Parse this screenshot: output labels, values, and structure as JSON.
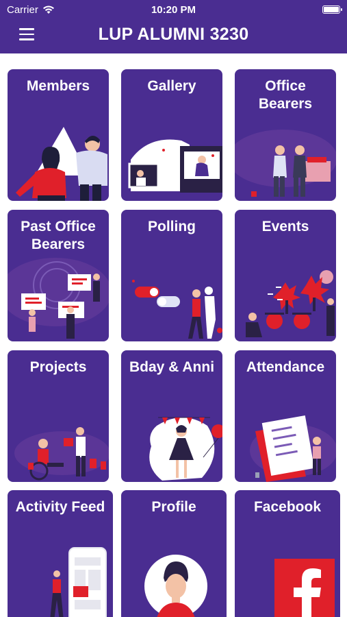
{
  "status_bar": {
    "carrier": "Carrier",
    "time": "10:20 PM"
  },
  "header": {
    "title": "LUP ALUMNI 3230"
  },
  "colors": {
    "brand": "#4a2d91",
    "accent": "#e0202a",
    "text": "#ffffff"
  },
  "tiles": [
    {
      "label": "Members",
      "icon": "members-illustration"
    },
    {
      "label": "Gallery",
      "icon": "gallery-illustration"
    },
    {
      "label": "Office\nBearers",
      "icon": "office-bearers-illustration"
    },
    {
      "label": "Past Office\nBearers",
      "icon": "past-office-bearers-illustration"
    },
    {
      "label": "Polling",
      "icon": "polling-illustration"
    },
    {
      "label": "Events",
      "icon": "events-illustration"
    },
    {
      "label": "Projects",
      "icon": "projects-illustration"
    },
    {
      "label": "Bday & Anni",
      "icon": "birthday-anniversary-illustration"
    },
    {
      "label": "Attendance",
      "icon": "attendance-illustration"
    },
    {
      "label": "Activity Feed",
      "icon": "activity-feed-illustration"
    },
    {
      "label": "Profile",
      "icon": "profile-avatar-illustration"
    },
    {
      "label": "Facebook",
      "icon": "facebook-icon"
    }
  ]
}
